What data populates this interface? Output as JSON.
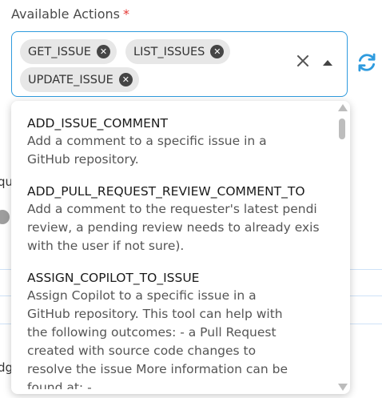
{
  "field": {
    "label": "Available Actions",
    "required_mark": "*"
  },
  "selected_chips": [
    {
      "label": "GET_ISSUE"
    },
    {
      "label": "LIST_ISSUES"
    },
    {
      "label": "UPDATE_ISSUE"
    }
  ],
  "icons": {
    "chip_remove": "close-circle-icon",
    "clear": "close-icon",
    "toggle": "caret-up-icon",
    "refresh": "refresh-icon"
  },
  "colors": {
    "accent": "#2f9bde",
    "required": "#e53935",
    "chip_bg": "#e7e7e7"
  },
  "background_fragments": {
    "a": "qu",
    "b": "dg"
  },
  "options": [
    {
      "title": "ADD_ISSUE_COMMENT",
      "description": "Add a comment to a specific issue in a\nGitHub repository."
    },
    {
      "title": "ADD_PULL_REQUEST_REVIEW_COMMENT_TO",
      "description": "Add a comment to the requester's latest pendi\nreview, a pending review needs to already exis\nwith the user if not sure)."
    },
    {
      "title": "ASSIGN_COPILOT_TO_ISSUE",
      "description": "Assign Copilot to a specific issue in a\nGitHub repository. This tool can help with\nthe following outcomes: - a Pull Request\ncreated with source code changes to\nresolve the issue More information can be\nfound at: -"
    }
  ]
}
